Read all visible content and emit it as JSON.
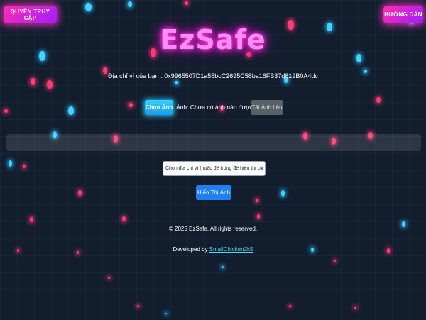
{
  "header": {
    "access_button_label": "QUYỀN TRUY CẬP",
    "guide_button_label": "HƯỚNG DẪN"
  },
  "logo": {
    "text": "EzSafe",
    "glow_color": "#ff38e0"
  },
  "wallet": {
    "label": "Địa chỉ ví của bạn :",
    "address": "0x9965507D1a55bcC2695C58ba16FB37d819B0A4dc"
  },
  "upload": {
    "choose_button_label": "Chọn Ảnh",
    "status_text": "Ảnh: Chưa có ảnh nào được chọn",
    "upload_button_label": "Tải Ảnh Lên"
  },
  "gallery": {
    "select_value": "Chọn địa chỉ ví (hoặc để trống để hiển thị của bạn)",
    "show_button_label": "Hiển Thị Ảnh"
  },
  "footer": {
    "copyright": "© 2025 EzSafe. All rights reserved.",
    "developed_prefix": "Developed by",
    "developer_link": "SmallChicken2k5"
  },
  "colors": {
    "background": "#121e2e",
    "accent_pink": "#ff2cb1",
    "accent_blue": "#38d2ff",
    "primary_button": "#1f7ff5"
  }
}
